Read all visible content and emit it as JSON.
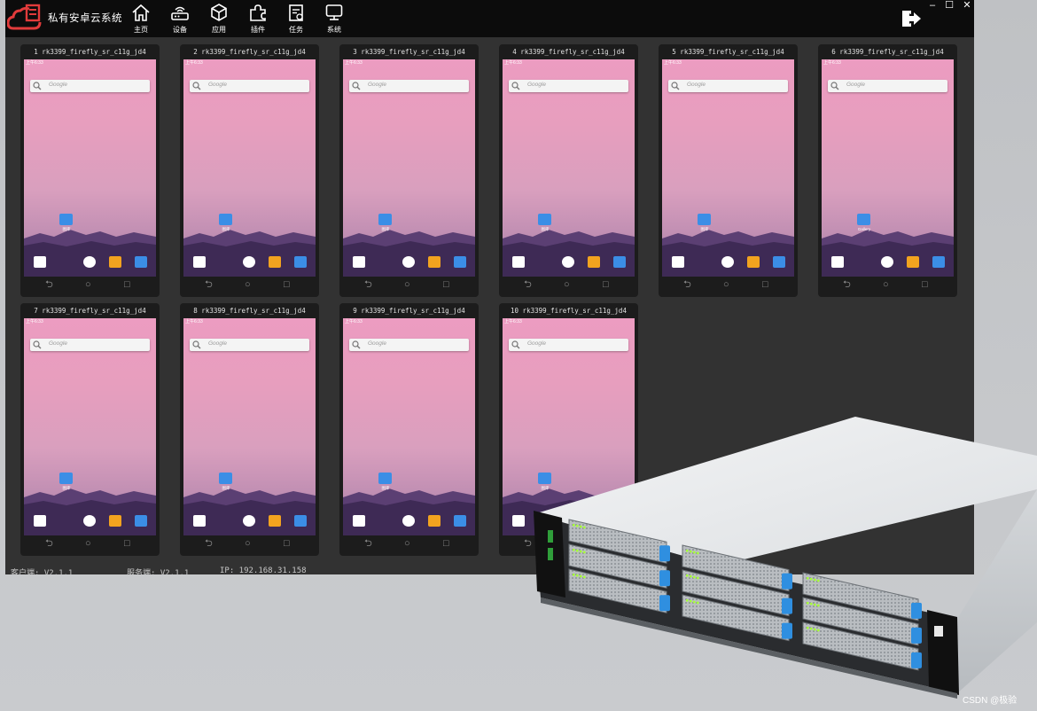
{
  "app": {
    "title": "私有安卓云系统",
    "nav": [
      {
        "label": "主页",
        "icon": "home-icon"
      },
      {
        "label": "设备",
        "icon": "router-icon"
      },
      {
        "label": "应用",
        "icon": "cube-icon"
      },
      {
        "label": "插件",
        "icon": "puzzle-icon"
      },
      {
        "label": "任务",
        "icon": "clipboard-icon"
      },
      {
        "label": "系统",
        "icon": "monitor-icon"
      }
    ],
    "window_controls": {
      "minimize": "–",
      "maximize": "☐",
      "close": "✕"
    },
    "exit_icon": "exit-icon"
  },
  "phones": [
    {
      "title": "1 rk3399_firefly_sr_c11g_jd4",
      "app_label": "图库"
    },
    {
      "title": "2 rk3399_firefly_sr_c11g_jd4",
      "app_label": "图库"
    },
    {
      "title": "3 rk3399_firefly_sr_c11g_jd4",
      "app_label": "图库"
    },
    {
      "title": "4 rk3399_firefly_sr_c11g_jd4",
      "app_label": "图库"
    },
    {
      "title": "5 rk3399_firefly_sr_c11g_jd4",
      "app_label": "图库"
    },
    {
      "title": "6 rk3399_firefly_sr_c11g_jd4",
      "app_label": "Gallery"
    },
    {
      "title": "7 rk3399_firefly_sr_c11g_jd4",
      "app_label": "图库"
    },
    {
      "title": "8 rk3399_firefly_sr_c11g_jd4",
      "app_label": "图库"
    },
    {
      "title": "9 rk3399_firefly_sr_c11g_jd4",
      "app_label": "图库"
    },
    {
      "title": "10 rk3399_firefly_sr_c11g_jd4",
      "app_label": "图库"
    }
  ],
  "phone_ui": {
    "search_placeholder": "Google",
    "status_time": "上午6:33",
    "nav_back": "⮌",
    "nav_home": "○",
    "nav_recent": "□"
  },
  "status_bar": {
    "client": "客户端: V2.1.1",
    "server": "服务端: V2.1.1",
    "ip": "IP: 192.168.31.158"
  },
  "watermark": "CSDN @极验",
  "colors": {
    "titlebar": "#0c0c0c",
    "workspace": "#323232",
    "logo_red": "#e23b3b",
    "wallpaper_top": "#ec9cc1",
    "wallpaper_bottom": "#3e2a55",
    "server_tray_accent": "#2f8fe0",
    "led_green": "#a6ff3a"
  }
}
